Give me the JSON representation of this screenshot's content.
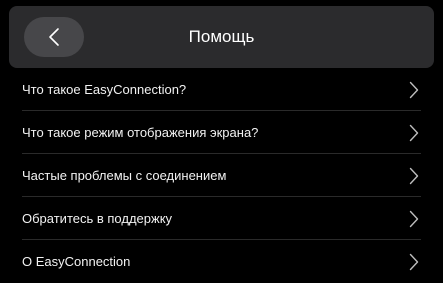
{
  "header": {
    "back_icon": "chevron-left-icon",
    "title": "Помощь"
  },
  "items": [
    {
      "label": "Что такое EasyConnection?",
      "icon": "chevron-right-icon"
    },
    {
      "label": "Что такое режим отображения экрана?",
      "icon": "chevron-right-icon"
    },
    {
      "label": "Частые проблемы с соединением",
      "icon": "chevron-right-icon"
    },
    {
      "label": "Обратитесь в поддержку",
      "icon": "chevron-right-icon"
    },
    {
      "label": "О EasyConnection",
      "icon": "chevron-right-icon"
    }
  ],
  "colors": {
    "background": "#000000",
    "header_background": "#2b2b2d",
    "back_button_background": "#47474a",
    "text": "#ffffff"
  }
}
